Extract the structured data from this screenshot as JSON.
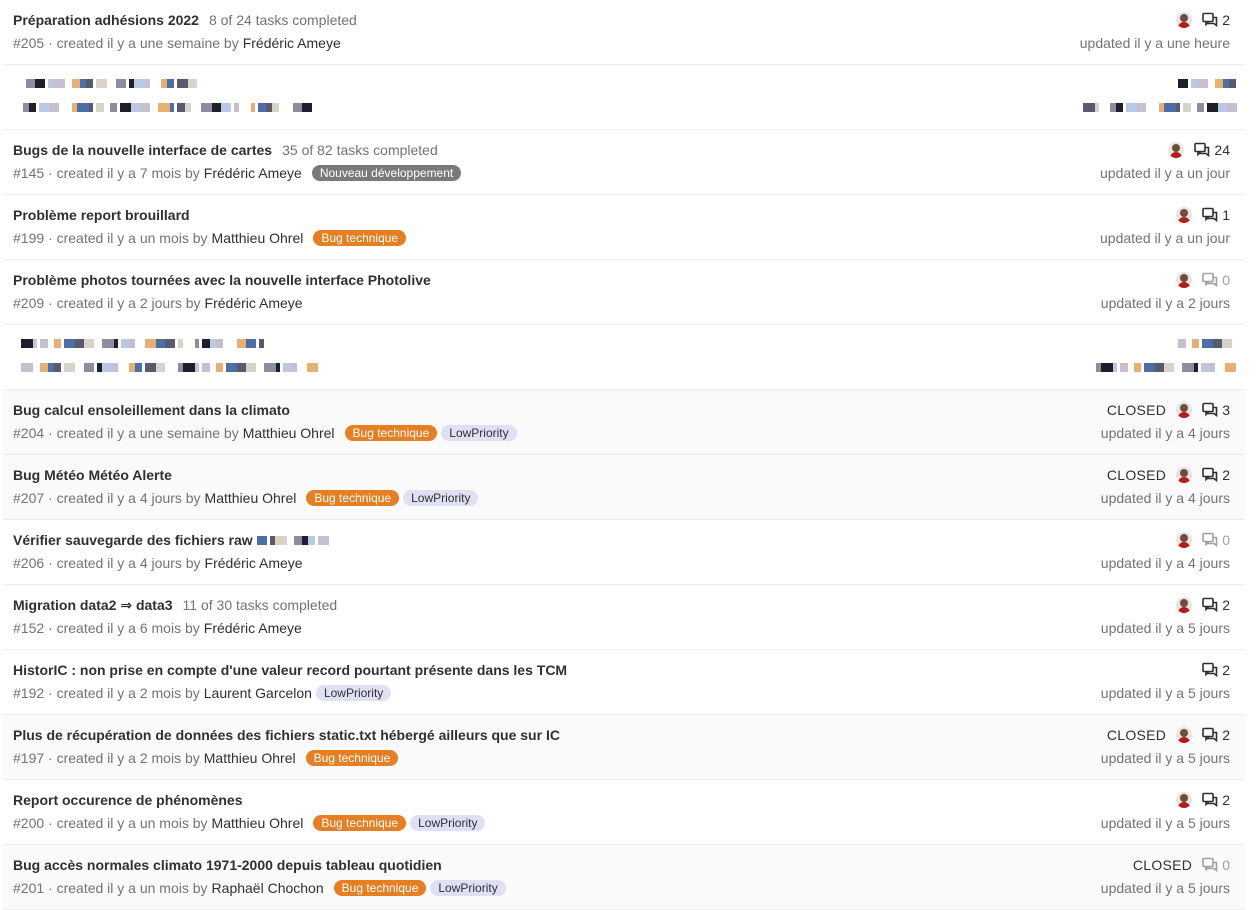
{
  "issues": [
    {
      "title": "Préparation adhésions 2022",
      "tasks": "8 of 24 tasks completed",
      "meta": "#205 · created il y a une semaine by",
      "author": "Frédéric Ameye",
      "labels": [],
      "closed": "",
      "avatar": true,
      "comments": "2",
      "updated": "updated il y a une heure"
    },
    {
      "redacted": true
    },
    {
      "title": "Bugs de la nouvelle interface de cartes",
      "tasks": "35 of 82 tasks completed",
      "meta": "#145 · created il y a 7 mois by",
      "author": "Frédéric Ameye",
      "labels": [
        {
          "text": "Nouveau développement",
          "color": "grey"
        }
      ],
      "closed": "",
      "avatar": true,
      "comments": "24",
      "updated": "updated il y a un jour"
    },
    {
      "title": "Problème report brouillard",
      "tasks": "",
      "meta": "#199 · created il y a un mois by",
      "author": "Matthieu Ohrel",
      "labels": [
        {
          "text": "Bug technique",
          "color": "orange"
        }
      ],
      "closed": "",
      "avatar": true,
      "comments": "1",
      "updated": "updated il y a un jour"
    },
    {
      "title": "Problème photos tournées avec la nouvelle interface Photolive",
      "tasks": "",
      "meta": "#209 · created il y a 2 jours by",
      "author": "Frédéric Ameye",
      "labels": [],
      "closed": "",
      "avatar": true,
      "comments": "0",
      "updated": "updated il y a 2 jours"
    },
    {
      "redacted": true
    },
    {
      "title": "Bug calcul ensoleillement dans la climato",
      "tasks": "",
      "meta": "#204 · created il y a une semaine by",
      "author": "Matthieu Ohrel",
      "labels": [
        {
          "text": "Bug technique",
          "color": "orange"
        },
        {
          "text": "LowPriority",
          "color": "lavender"
        }
      ],
      "closed": "CLOSED",
      "avatar": true,
      "comments": "3",
      "updated": "updated il y a 4 jours"
    },
    {
      "title": "Bug Météo Météo Alerte",
      "tasks": "",
      "meta": "#207 · created il y a 4 jours by",
      "author": "Matthieu Ohrel",
      "labels": [
        {
          "text": "Bug technique",
          "color": "orange"
        },
        {
          "text": "LowPriority",
          "color": "lavender"
        }
      ],
      "closed": "CLOSED",
      "avatar": true,
      "comments": "2",
      "updated": "updated il y a 4 jours"
    },
    {
      "title": "Vérifier sauvegarde des fichiers raw",
      "tasks": "",
      "meta": "#206 · created il y a 4 jours by",
      "author": "Frédéric Ameye",
      "labels": [],
      "closed": "",
      "avatar": true,
      "comments": "0",
      "updated": "updated il y a 4 jours",
      "partial_redact": true
    },
    {
      "title": "Migration data2 ⇒ data3",
      "tasks": "11 of 30 tasks completed",
      "meta": "#152 · created il y a 6 mois by",
      "author": "Frédéric Ameye",
      "labels": [],
      "closed": "",
      "avatar": true,
      "comments": "2",
      "updated": "updated il y a 5 jours"
    },
    {
      "title": "HistorIC : non prise en compte d'une valeur record pourtant présente dans les TCM",
      "tasks": "",
      "meta": "#192 · created il y a 2 mois by",
      "author": "Laurent Garcelon",
      "labels": [
        {
          "text": "LowPriority",
          "color": "lavender"
        }
      ],
      "closed": "",
      "avatar": false,
      "comments": "2",
      "updated": "updated il y a 5 jours"
    },
    {
      "title": "Plus de récupération de données des fichiers static.txt hébergé ailleurs que sur IC",
      "tasks": "",
      "meta": "#197 · created il y a 2 mois by",
      "author": "Matthieu Ohrel",
      "labels": [
        {
          "text": "Bug technique",
          "color": "orange"
        }
      ],
      "closed": "CLOSED",
      "avatar": true,
      "comments": "2",
      "updated": "updated il y a 5 jours"
    },
    {
      "title": "Report occurence de phénomènes",
      "tasks": "",
      "meta": "#200 · created il y a un mois by",
      "author": "Matthieu Ohrel",
      "labels": [
        {
          "text": "Bug technique",
          "color": "orange"
        },
        {
          "text": "LowPriority",
          "color": "lavender"
        }
      ],
      "closed": "",
      "avatar": true,
      "comments": "2",
      "updated": "updated il y a 5 jours"
    },
    {
      "title": "Bug accès normales climato 1971-2000 depuis tableau quotidien",
      "tasks": "",
      "meta": "#201 · created il y a un mois by",
      "author": "Raphaël Chochon",
      "labels": [
        {
          "text": "Bug technique",
          "color": "orange"
        },
        {
          "text": "LowPriority",
          "color": "lavender"
        }
      ],
      "closed": "CLOSED",
      "avatar": false,
      "comments": "0",
      "updated": "updated il y a 5 jours"
    }
  ],
  "colors": {
    "orange": "#e67e22",
    "grey": "#7a7a7a",
    "lavender": "#e0e0f5",
    "closed_bg": "#fafafa"
  },
  "icons": {
    "comment": "comments-icon",
    "avatar": "avatar-icon"
  }
}
